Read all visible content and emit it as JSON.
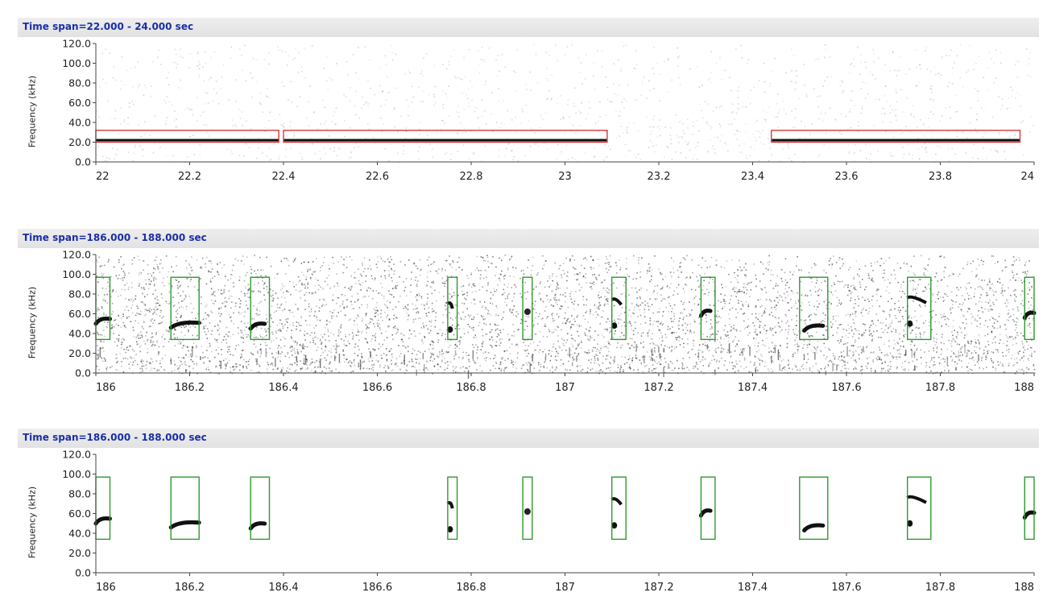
{
  "colors": {
    "header_text": "#1b2fa8",
    "red_box": "#d43a3a",
    "green_box": "#2d9a2d",
    "axis": "#444444"
  },
  "panels": [
    {
      "title": "Time span=22.000 - 24.000 sec",
      "ylabel": "Frequency (kHz)",
      "yticks": [
        "120.0",
        "100.0",
        "80.0",
        "60.0",
        "40.0",
        "20.0",
        "0.0"
      ],
      "xticks": [
        "22",
        "22.2",
        "22.4",
        "22.6",
        "22.8",
        "23",
        "23.2",
        "23.4",
        "23.6",
        "23.8",
        "24"
      ],
      "x_range": [
        22.0,
        24.0
      ],
      "y_range": [
        0,
        120
      ],
      "noise": "light",
      "detections": [
        {
          "type": "red",
          "t0": 22.0,
          "t1": 22.39,
          "f0": 20,
          "f1": 32
        },
        {
          "type": "red",
          "t0": 22.4,
          "t1": 23.09,
          "f0": 20,
          "f1": 32
        },
        {
          "type": "red",
          "t0": 23.44,
          "t1": 23.97,
          "f0": 20,
          "f1": 32
        }
      ],
      "calls": [
        {
          "t0": 22.0,
          "t1": 22.39,
          "f": 22,
          "shape": "flat"
        },
        {
          "t0": 22.4,
          "t1": 23.09,
          "f": 22,
          "shape": "flat"
        },
        {
          "t0": 23.44,
          "t1": 23.97,
          "f": 22,
          "shape": "flat"
        }
      ]
    },
    {
      "title": "Time span=186.000 - 188.000 sec",
      "ylabel": "Frequency (kHz)",
      "yticks": [
        "120.0",
        "100.0",
        "80.0",
        "60.0",
        "40.0",
        "20.0",
        "0.0"
      ],
      "xticks": [
        "186",
        "186.2",
        "186.4",
        "186.6",
        "186.8",
        "187",
        "187.2",
        "187.4",
        "187.6",
        "187.8",
        "188"
      ],
      "x_range": [
        186.0,
        188.0
      ],
      "y_range": [
        0,
        120
      ],
      "noise": "heavy",
      "detections": [
        {
          "type": "green",
          "t0": 186.0,
          "t1": 186.03,
          "f0": 34,
          "f1": 97
        },
        {
          "type": "green",
          "t0": 186.16,
          "t1": 186.22,
          "f0": 34,
          "f1": 97
        },
        {
          "type": "green",
          "t0": 186.33,
          "t1": 186.37,
          "f0": 34,
          "f1": 97
        },
        {
          "type": "green",
          "t0": 186.75,
          "t1": 186.77,
          "f0": 34,
          "f1": 97
        },
        {
          "type": "green",
          "t0": 186.91,
          "t1": 186.93,
          "f0": 34,
          "f1": 97
        },
        {
          "type": "green",
          "t0": 187.1,
          "t1": 187.13,
          "f0": 34,
          "f1": 97
        },
        {
          "type": "green",
          "t0": 187.29,
          "t1": 187.32,
          "f0": 34,
          "f1": 97
        },
        {
          "type": "green",
          "t0": 187.5,
          "t1": 187.56,
          "f0": 34,
          "f1": 97
        },
        {
          "type": "green",
          "t0": 187.73,
          "t1": 187.78,
          "f0": 34,
          "f1": 97
        },
        {
          "type": "green",
          "t0": 187.98,
          "t1": 188.0,
          "f0": 34,
          "f1": 97
        }
      ],
      "calls": [
        {
          "t0": 186.0,
          "t1": 186.03,
          "f": 54,
          "shape": "hook"
        },
        {
          "t0": 186.16,
          "t1": 186.22,
          "f": 50,
          "shape": "rise"
        },
        {
          "t0": 186.33,
          "t1": 186.36,
          "f": 49,
          "shape": "rise"
        },
        {
          "t0": 186.75,
          "t1": 186.76,
          "f": 66,
          "shape": "split"
        },
        {
          "t0": 186.91,
          "t1": 186.93,
          "f": 62,
          "shape": "dot"
        },
        {
          "t0": 187.1,
          "t1": 187.12,
          "f": 70,
          "shape": "split"
        },
        {
          "t0": 187.29,
          "t1": 187.31,
          "f": 62,
          "shape": "rise"
        },
        {
          "t0": 187.51,
          "t1": 187.55,
          "f": 47,
          "shape": "rise"
        },
        {
          "t0": 187.73,
          "t1": 187.77,
          "f": 72,
          "shape": "split"
        },
        {
          "t0": 187.98,
          "t1": 188.0,
          "f": 60,
          "shape": "rise"
        }
      ]
    },
    {
      "title": "Time span=186.000 - 188.000 sec",
      "ylabel": "Frequency (kHz)",
      "yticks": [
        "120.0",
        "100.0",
        "80.0",
        "60.0",
        "40.0",
        "20.0",
        "0.0"
      ],
      "xticks": [
        "186",
        "186.2",
        "186.4",
        "186.6",
        "186.8",
        "187",
        "187.2",
        "187.4",
        "187.6",
        "187.8",
        "188"
      ],
      "x_range": [
        186.0,
        188.0
      ],
      "y_range": [
        0,
        120
      ],
      "noise": "none",
      "detections": [
        {
          "type": "green",
          "t0": 186.0,
          "t1": 186.03,
          "f0": 34,
          "f1": 97
        },
        {
          "type": "green",
          "t0": 186.16,
          "t1": 186.22,
          "f0": 34,
          "f1": 97
        },
        {
          "type": "green",
          "t0": 186.33,
          "t1": 186.37,
          "f0": 34,
          "f1": 97
        },
        {
          "type": "green",
          "t0": 186.75,
          "t1": 186.77,
          "f0": 34,
          "f1": 97
        },
        {
          "type": "green",
          "t0": 186.91,
          "t1": 186.93,
          "f0": 34,
          "f1": 97
        },
        {
          "type": "green",
          "t0": 187.1,
          "t1": 187.13,
          "f0": 34,
          "f1": 97
        },
        {
          "type": "green",
          "t0": 187.29,
          "t1": 187.32,
          "f0": 34,
          "f1": 97
        },
        {
          "type": "green",
          "t0": 187.5,
          "t1": 187.56,
          "f0": 34,
          "f1": 97
        },
        {
          "type": "green",
          "t0": 187.73,
          "t1": 187.78,
          "f0": 34,
          "f1": 97
        },
        {
          "type": "green",
          "t0": 187.98,
          "t1": 188.0,
          "f0": 34,
          "f1": 97
        }
      ],
      "calls": [
        {
          "t0": 186.0,
          "t1": 186.03,
          "f": 54,
          "shape": "hook"
        },
        {
          "t0": 186.16,
          "t1": 186.22,
          "f": 50,
          "shape": "rise"
        },
        {
          "t0": 186.33,
          "t1": 186.36,
          "f": 49,
          "shape": "rise"
        },
        {
          "t0": 186.75,
          "t1": 186.76,
          "f": 66,
          "shape": "split"
        },
        {
          "t0": 186.91,
          "t1": 186.93,
          "f": 62,
          "shape": "dot"
        },
        {
          "t0": 187.1,
          "t1": 187.12,
          "f": 70,
          "shape": "split"
        },
        {
          "t0": 187.29,
          "t1": 187.31,
          "f": 62,
          "shape": "rise"
        },
        {
          "t0": 187.51,
          "t1": 187.55,
          "f": 47,
          "shape": "rise"
        },
        {
          "t0": 187.73,
          "t1": 187.77,
          "f": 72,
          "shape": "split"
        },
        {
          "t0": 187.98,
          "t1": 188.0,
          "f": 60,
          "shape": "rise"
        }
      ]
    }
  ]
}
